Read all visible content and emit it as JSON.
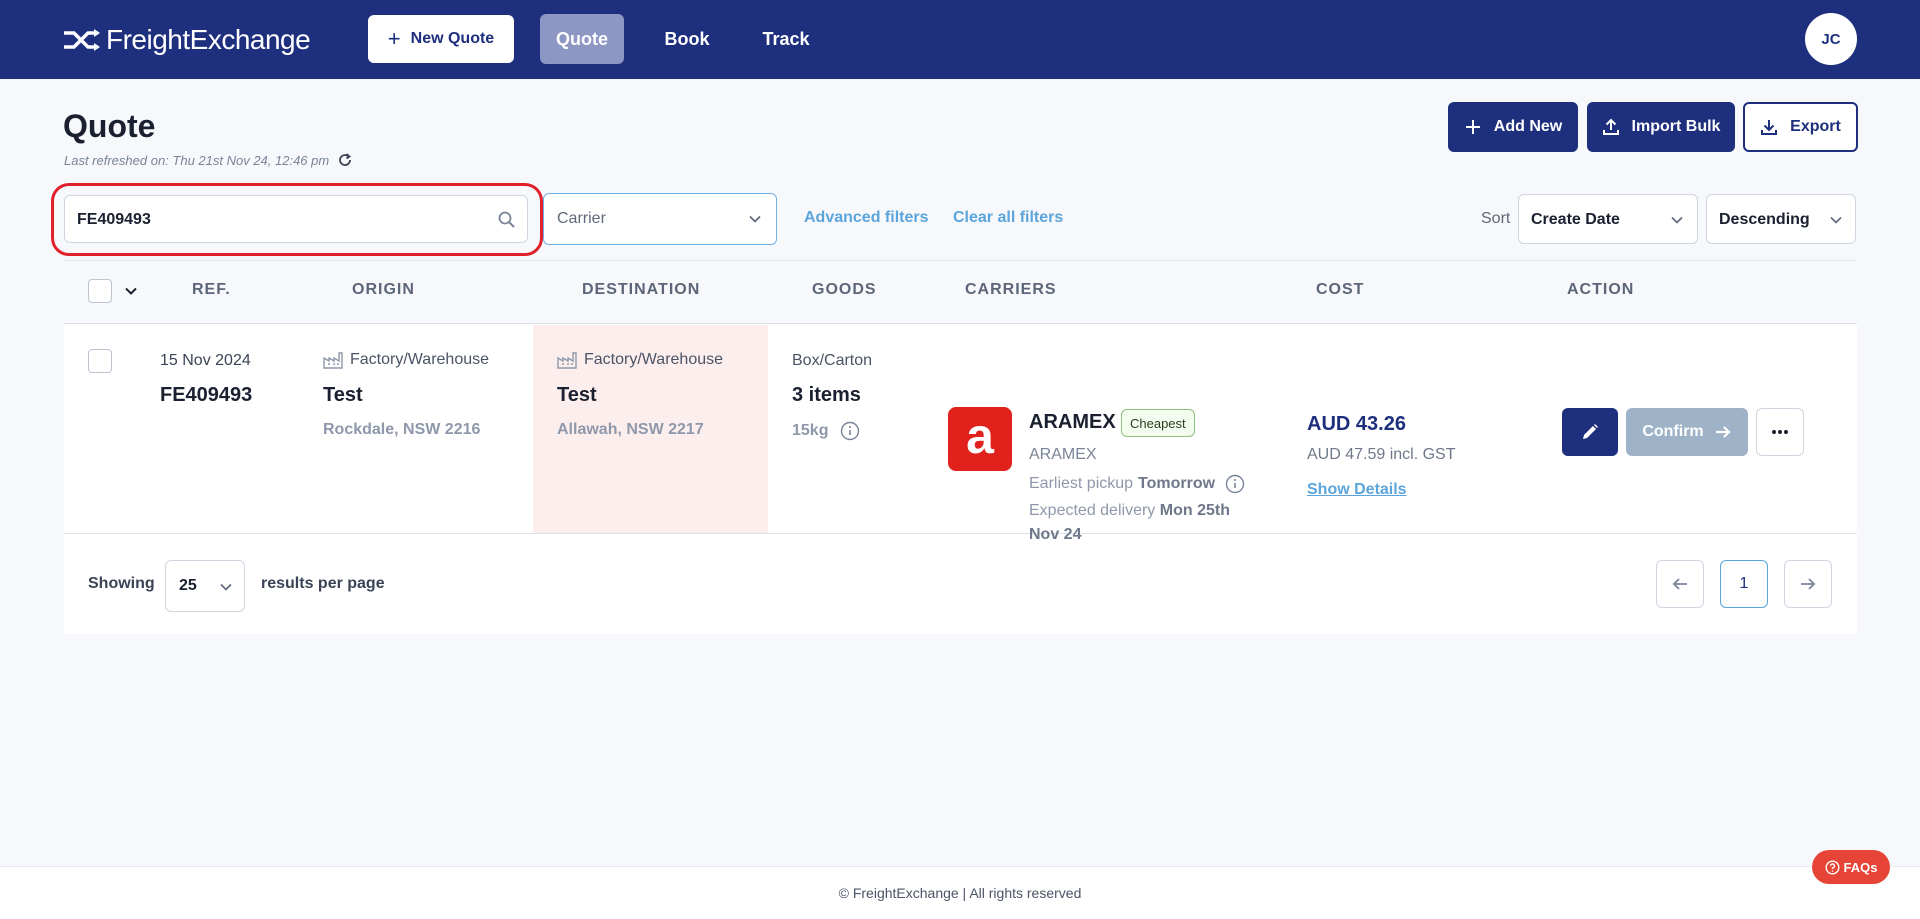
{
  "brand": {
    "name": "FreightExchange"
  },
  "nav": {
    "new_quote": "New Quote",
    "items": [
      "Quote",
      "Book",
      "Track"
    ],
    "avatar_initials": "JC"
  },
  "header": {
    "title": "Quote",
    "last_refreshed": "Last refreshed on: Thu 21st Nov 24, 12:46 pm",
    "add_new": "Add New",
    "import_bulk": "Import Bulk",
    "export": "Export"
  },
  "filters": {
    "search_value": "FE409493",
    "carrier_placeholder": "Carrier",
    "advanced_filters": "Advanced filters",
    "clear_all": "Clear all filters",
    "sort_label": "Sort",
    "sort_field": "Create Date",
    "sort_order": "Descending"
  },
  "table": {
    "columns": [
      "REF.",
      "ORIGIN",
      "DESTINATION",
      "GOODS",
      "CARRIERS",
      "COST",
      "ACTION"
    ],
    "rows": [
      {
        "date": "15 Nov 2024",
        "ref": "FE409493",
        "origin": {
          "type": "Factory/Warehouse",
          "name": "Test",
          "location": "Rockdale, NSW 2216"
        },
        "destination": {
          "type": "Factory/Warehouse",
          "name": "Test",
          "location": "Allawah, NSW 2217"
        },
        "goods": {
          "type": "Box/Carton",
          "items": "3 items",
          "weight": "15kg"
        },
        "carrier": {
          "logo_letter": "a",
          "name": "ARAMEX",
          "badge": "Cheapest",
          "service": "ARAMEX",
          "pickup_label": "Earliest pickup",
          "pickup_value": "Tomorrow",
          "delivery_label": "Expected delivery",
          "delivery_value_1": "Mon 25th",
          "delivery_value_2": "Nov 24"
        },
        "cost": {
          "price": "AUD 43.26",
          "incl_gst": "AUD 47.59 incl. GST",
          "show_details": "Show Details"
        },
        "action": {
          "confirm": "Confirm"
        }
      }
    ]
  },
  "pagination": {
    "showing": "Showing",
    "per_page": "25",
    "results_label": "results per page",
    "current_page": "1"
  },
  "footer": {
    "text": "© FreightExchange | All rights reserved"
  },
  "faq": {
    "label": "FAQs"
  },
  "colors": {
    "primary": "#1e2f7e",
    "accent": "#5ba5dc",
    "highlight": "#e0202a",
    "carrier_brand": "#e1221c"
  }
}
